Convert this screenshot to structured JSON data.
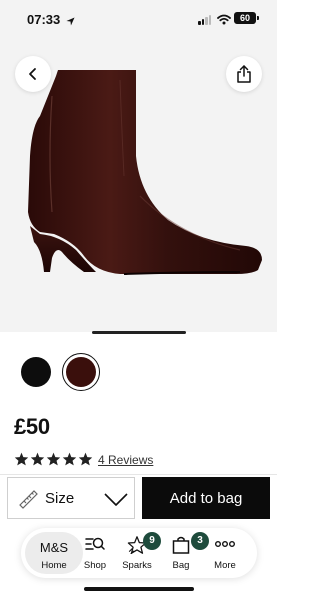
{
  "status_bar": {
    "time": "07:33",
    "battery": "60"
  },
  "product": {
    "image_alt": "brown leather ankle boot",
    "price": "£50",
    "rating": 5,
    "reviews_label": "4 Reviews",
    "swatches": [
      {
        "name": "black",
        "color": "#0d0d0d",
        "selected": false
      },
      {
        "name": "brown",
        "color": "#3a0f0c",
        "selected": true
      }
    ]
  },
  "actions": {
    "size_label": "Size",
    "add_to_bag_label": "Add to bag"
  },
  "bottom_nav": {
    "home_logo": "M&S",
    "home_label": "Home",
    "shop_label": "Shop",
    "sparks_label": "Sparks",
    "sparks_badge": "9",
    "bag_label": "Bag",
    "bag_badge": "3",
    "more_label": "More"
  },
  "colors": {
    "accent_badge": "#1e4b3c",
    "primary_button": "#0b0b0b",
    "hero_background": "#f3f3f3"
  },
  "icons": [
    "location-arrow-icon",
    "signal-icon",
    "wifi-icon",
    "battery-icon",
    "back-arrow-icon",
    "share-icon",
    "star-icon",
    "ruler-icon",
    "chevron-down-icon",
    "shop-search-icon",
    "sparks-star-icon",
    "bag-icon",
    "more-dots-icon"
  ]
}
